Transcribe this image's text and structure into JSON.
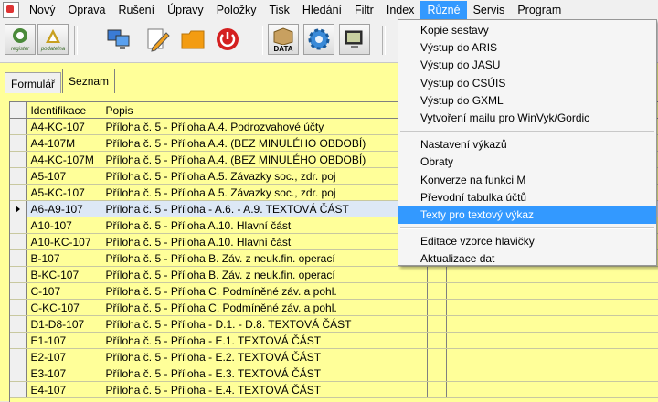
{
  "menubar": {
    "items": [
      "Nový",
      "Oprava",
      "Rušení",
      "Úpravy",
      "Položky",
      "Tisk",
      "Hledání",
      "Filtr",
      "Index",
      "Různé",
      "Servis",
      "Program"
    ],
    "active_index": 9
  },
  "toolbar": {
    "logo1_label": "register",
    "logo2_label": "podatelna",
    "data_button_label": "DATA"
  },
  "tabs": [
    "Formulář",
    "Seznam"
  ],
  "selected_tab": 1,
  "grid": {
    "columns": [
      "Identifikace",
      "Popis"
    ],
    "current_row": 5,
    "rows": [
      [
        "A4-KC-107",
        "Příloha č. 5 - Příloha A.4. Podrozvahové účty"
      ],
      [
        "A4-107M",
        "Příloha č. 5 - Příloha A.4. (BEZ MINULÉHO OBDOBÍ)"
      ],
      [
        "A4-KC-107M",
        "Příloha č. 5 - Příloha A.4. (BEZ MINULÉHO OBDOBÍ)"
      ],
      [
        "A5-107",
        "Příloha č. 5 - Příloha A.5. Závazky soc., zdr. poj"
      ],
      [
        "A5-KC-107",
        "Příloha č. 5 - Příloha A.5. Závazky soc., zdr. poj"
      ],
      [
        "A6-A9-107",
        "Příloha č. 5 - Příloha - A.6. - A.9. TEXTOVÁ ČÁST"
      ],
      [
        "A10-107",
        "Příloha č. 5 - Příloha A.10. Hlavní část"
      ],
      [
        "A10-KC-107",
        "Příloha č. 5 - Příloha A.10. Hlavní část"
      ],
      [
        "B-107",
        "Příloha č. 5 - Příloha B. Záv. z neuk.fin. operací"
      ],
      [
        "B-KC-107",
        "Příloha č. 5 - Příloha B. Záv. z neuk.fin. operací"
      ],
      [
        "C-107",
        "Příloha č. 5 - Příloha C. Podmíněné záv. a pohl."
      ],
      [
        "C-KC-107",
        "Příloha č. 5 - Příloha C. Podmíněné záv. a pohl."
      ],
      [
        "D1-D8-107",
        "Příloha č. 5 - Příloha - D.1. - D.8. TEXTOVÁ ČÁST"
      ],
      [
        "E1-107",
        "Příloha č. 5 - Příloha - E.1. TEXTOVÁ ČÁST"
      ],
      [
        "E2-107",
        "Příloha č. 5 - Příloha - E.2. TEXTOVÁ ČÁST"
      ],
      [
        "E3-107",
        "Příloha č. 5 - Příloha - E.3. TEXTOVÁ ČÁST"
      ],
      [
        "E4-107",
        "Příloha č. 5 - Příloha - E.4. TEXTOVÁ ČÁST"
      ]
    ]
  },
  "dropdown": {
    "groups": [
      [
        "Kopie sestavy",
        "Výstup do ARIS",
        "Výstup do JASU",
        "Výstup do CSÚIS",
        "Výstup do GXML",
        "Vytvoření mailu pro WinVyk/Gordic"
      ],
      [
        "Nastavení výkazů",
        "Obraty",
        "Konverze na funkci M",
        "Převodní tabulka účtů",
        "Texty pro textový výkaz"
      ],
      [
        "Editace vzorce hlavičky",
        "Aktualizace dat"
      ]
    ],
    "highlighted": "Texty pro textový výkaz"
  },
  "colors": {
    "workspace_bg": "#ffff99",
    "menu_highlight": "#3399ff",
    "current_row_bg": "#dde8f6"
  }
}
